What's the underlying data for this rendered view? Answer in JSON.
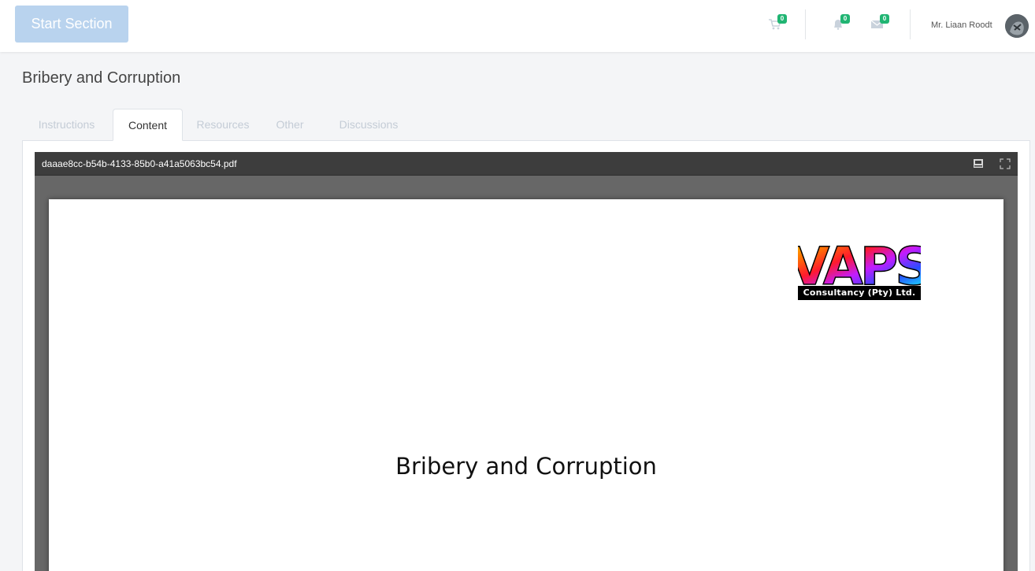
{
  "header": {
    "start_button_label": "Start Section",
    "cart_badge": "0",
    "notifications_badge": "0",
    "messages_badge": "0",
    "user_name": "Mr. Liaan Roodt"
  },
  "page": {
    "title": "Bribery and Corruption"
  },
  "tabs": [
    {
      "label": "Instructions",
      "active": false
    },
    {
      "label": "Content",
      "active": true
    },
    {
      "label": "Resources",
      "active": false
    },
    {
      "label": "Other",
      "active": false
    },
    {
      "label": "Discussions",
      "active": false
    }
  ],
  "pdf": {
    "filename": "daaae8cc-b54b-4133-85b0-a41a5063bc54.pdf",
    "toolbar_icons": [
      "download-icon",
      "fullscreen-icon"
    ],
    "page_heading": "Bribery and Corruption",
    "logo": {
      "text": "VAPS",
      "caption": "Consultancy (Pty) Ltd."
    }
  },
  "colors": {
    "accent_button": "#b9d3ee",
    "badge": "#21b573",
    "pdf_toolbar": "#3d3d3d",
    "pdf_background": "#676767"
  }
}
